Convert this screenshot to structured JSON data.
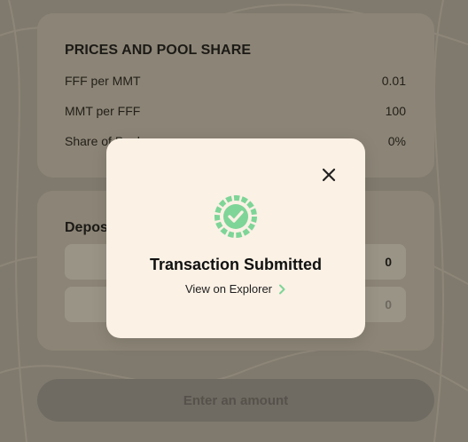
{
  "prices": {
    "title": "PRICES AND POOL SHARE",
    "rows": [
      {
        "label": "FFF per MMT",
        "value": "0.01"
      },
      {
        "label": "MMT per FFF",
        "value": "100"
      },
      {
        "label": "Share of Pool",
        "value": "0%"
      }
    ]
  },
  "deposit": {
    "title": "Deposit",
    "amounts": [
      "0",
      "0"
    ]
  },
  "actions": {
    "enter_amount_label": "Enter an amount"
  },
  "modal": {
    "title": "Transaction Submitted",
    "explorer_link": "View on Explorer",
    "close_icon": "close-icon",
    "status_icon": "check-circle-icon",
    "accent_color": "#7ed597"
  }
}
